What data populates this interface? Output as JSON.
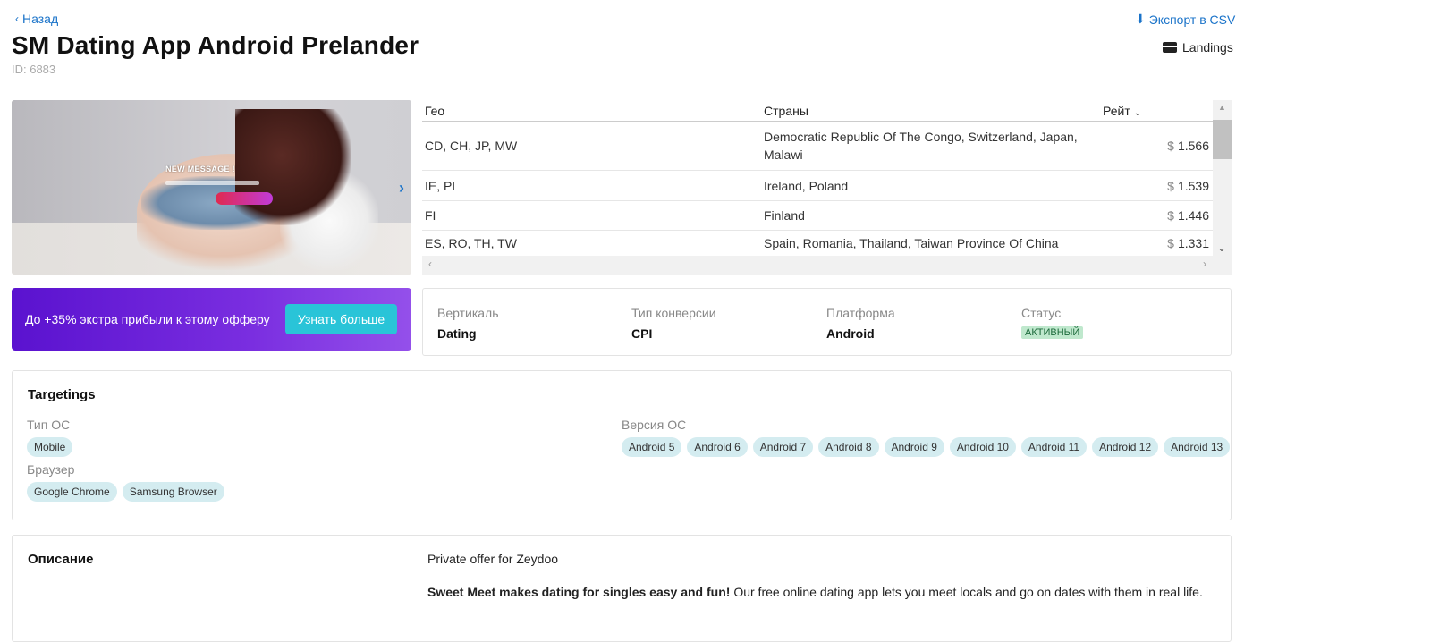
{
  "nav": {
    "back_label": "Назад",
    "export_label": "Экспорт в CSV",
    "landings_label": "Landings"
  },
  "offer": {
    "title": "SM Dating App Android Prelander",
    "id_text": "ID: 6883"
  },
  "preview": {
    "message_title": "NEW MESSAGE !"
  },
  "geo_table": {
    "headers": [
      "Гео",
      "Страны",
      "Рейт"
    ],
    "currency": "$",
    "rows": [
      {
        "geo": "CD, CH, JP, MW",
        "countries": "Democratic Republic Of The Congo, Switzerland, Japan, Malawi",
        "rate": "1.566"
      },
      {
        "geo": "IE, PL",
        "countries": "Ireland, Poland",
        "rate": "1.539"
      },
      {
        "geo": "FI",
        "countries": "Finland",
        "rate": "1.446"
      },
      {
        "geo": "ES, RO, TH, TW",
        "countries": "Spain, Romania, Thailand, Taiwan Province Of China",
        "rate": "1.331"
      }
    ]
  },
  "promo": {
    "text": "До +35% экстра прибыли к этому офферу",
    "button_label": "Узнать больше"
  },
  "info": {
    "vertical_label": "Вертикаль",
    "vertical_value": "Dating",
    "conversion_label": "Тип конверсии",
    "conversion_value": "CPI",
    "platform_label": "Платформа",
    "platform_value": "Android",
    "status_label": "Статус",
    "status_value": "АКТИВНЫЙ"
  },
  "targetings": {
    "title": "Targetings",
    "os_type_label": "Тип ОС",
    "os_type_chips": [
      "Mobile"
    ],
    "browser_label": "Браузер",
    "browser_chips": [
      "Google Chrome",
      "Samsung Browser"
    ],
    "os_version_label": "Версия ОС",
    "os_version_chips": [
      "Android 5",
      "Android 6",
      "Android 7",
      "Android 8",
      "Android 9",
      "Android 10",
      "Android 11",
      "Android 12",
      "Android 13"
    ]
  },
  "description": {
    "title": "Описание",
    "line1": "Private offer for Zeydoo",
    "line2_bold": "Sweet Meet makes dating for singles easy and fun!",
    "line2_rest": " Our free online dating app lets you meet locals and go on dates with them in real life."
  },
  "colors": {
    "link": "#1a73c9",
    "promo_gradient_start": "#5a12cf",
    "promo_button": "#29c4d8",
    "chip_bg": "#d4ecf0",
    "status_bg": "#bfe8cd"
  },
  "icons": [
    "chevron-left-icon",
    "download-icon",
    "landings-icon",
    "chevron-right-icon",
    "sort-chevron-icon"
  ]
}
